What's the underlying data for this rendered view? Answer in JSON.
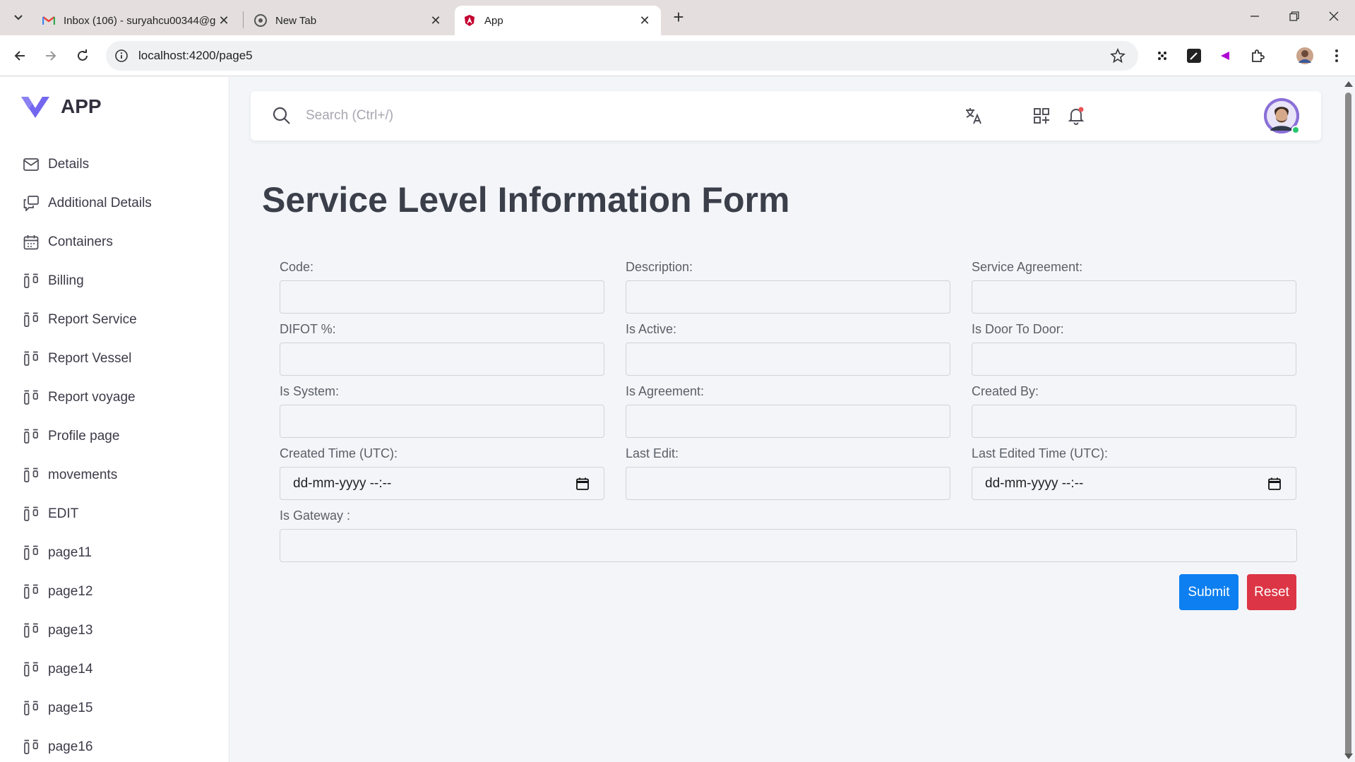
{
  "browser": {
    "tabs": [
      {
        "title": "Inbox (106) - suryahcu00344@g",
        "icon": "gmail-icon"
      },
      {
        "title": "New Tab",
        "icon": "chrome-icon"
      },
      {
        "title": "App",
        "icon": "angular-icon"
      }
    ],
    "url": "localhost:4200/page5"
  },
  "brand": {
    "name": "APP",
    "color": "#7367f0"
  },
  "sidebar": {
    "items": [
      {
        "label": "Details",
        "icon": "mail-icon"
      },
      {
        "label": "Additional Details",
        "icon": "message-square-icon"
      },
      {
        "label": "Containers",
        "icon": "calendar-icon"
      },
      {
        "label": "Billing",
        "icon": "kanban-icon"
      },
      {
        "label": "Report Service",
        "icon": "kanban-icon"
      },
      {
        "label": "Report Vessel",
        "icon": "kanban-icon"
      },
      {
        "label": "Report voyage",
        "icon": "kanban-icon"
      },
      {
        "label": "Profile page",
        "icon": "kanban-icon"
      },
      {
        "label": "movements",
        "icon": "kanban-icon"
      },
      {
        "label": "EDIT",
        "icon": "kanban-icon"
      },
      {
        "label": "page11",
        "icon": "kanban-icon"
      },
      {
        "label": "page12",
        "icon": "kanban-icon"
      },
      {
        "label": "page13",
        "icon": "kanban-icon"
      },
      {
        "label": "page14",
        "icon": "kanban-icon"
      },
      {
        "label": "page15",
        "icon": "kanban-icon"
      },
      {
        "label": "page16",
        "icon": "kanban-icon"
      }
    ]
  },
  "search": {
    "placeholder": "Search (Ctrl+/)"
  },
  "form": {
    "title": "Service Level Information Form",
    "fields": {
      "code": {
        "label": "Code:",
        "value": ""
      },
      "description": {
        "label": "Description:",
        "value": ""
      },
      "service_agreement": {
        "label": "Service Agreement:",
        "value": ""
      },
      "difot": {
        "label": "DIFOT %:",
        "value": ""
      },
      "is_active": {
        "label": "Is Active:",
        "value": ""
      },
      "is_door_to_door": {
        "label": "Is Door To Door:",
        "value": ""
      },
      "is_system": {
        "label": "Is System:",
        "value": ""
      },
      "is_agreement": {
        "label": "Is Agreement:",
        "value": ""
      },
      "created_by": {
        "label": "Created By:",
        "value": ""
      },
      "created_time": {
        "label": "Created Time (UTC):",
        "placeholder": "dd-mm-yyyy --:--"
      },
      "last_edit": {
        "label": "Last Edit:",
        "value": ""
      },
      "last_edited_time": {
        "label": "Last Edited Time (UTC):",
        "placeholder": "dd-mm-yyyy --:--"
      },
      "is_gateway": {
        "label": "Is Gateway :",
        "value": ""
      }
    },
    "submit_label": "Submit",
    "reset_label": "Reset"
  },
  "colors": {
    "submit": "#0d7ff0",
    "reset": "#dc3545",
    "notification_dot": "#ea5455",
    "online": "#28c76f"
  }
}
